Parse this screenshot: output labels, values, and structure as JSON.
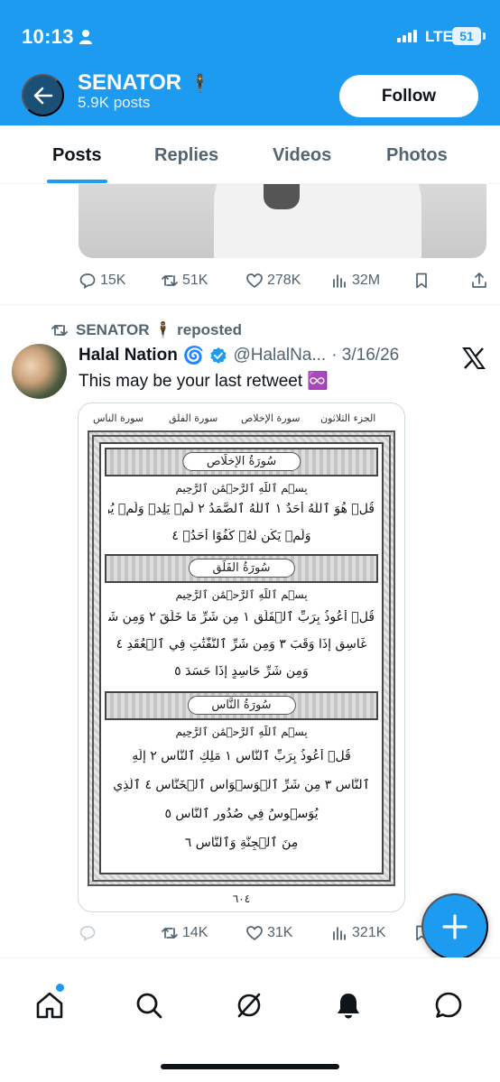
{
  "status_bar": {
    "time": "10:13",
    "network": "LTE",
    "battery": "51"
  },
  "header": {
    "name": "SENATOR",
    "name_emoji": "🕴",
    "posts": "5.9K posts",
    "follow_label": "Follow"
  },
  "tabs": [
    {
      "label": "Posts",
      "active": true
    },
    {
      "label": "Replies",
      "active": false
    },
    {
      "label": "Videos",
      "active": false
    },
    {
      "label": "Photos",
      "active": false
    }
  ],
  "previous_post": {
    "replies": "15K",
    "reposts": "51K",
    "likes": "278K",
    "views": "32M"
  },
  "repost": {
    "reposter": "SENATOR 🕴 reposted",
    "author": "Halal Nation",
    "author_emoji": "🌀",
    "handle": "@HalalNa...",
    "date": "· 3/16/26",
    "text": "This may be your last retweet ♾️",
    "quran_page": {
      "header_right": "الجزء الثلاثون",
      "header_mid1": "سورة الإخلاص",
      "header_mid2": "سورة الفلق",
      "header_left": "سورة الناس",
      "surah1_title": "سُورَةُ الإخلَاص",
      "surah2_title": "سُورَةُ الفَلَق",
      "surah3_title": "سُورَةُ النَّاس",
      "basmala": "بِسۡمِ ٱللَّهِ ٱلرَّحۡمَٰنِ ٱلرَّحِيمِ",
      "s1_l1": "قُلۡ هُوَ ٱللَّهُ أَحَدٌ ١ ٱللَّهُ ٱلصَّمَدُ ٢ لَمۡ يَلِدۡ وَلَمۡ يُولَدۡ ٣",
      "s1_l2": "وَلَمۡ يَكُن لَّهُۥ كُفُوًا أَحَدُۢ ٤",
      "s2_l1": "قُلۡ أَعُوذُ بِرَبِّ ٱلۡفَلَقِ ١ مِن شَرِّ مَا خَلَقَ ٢ وَمِن شَرِّ",
      "s2_l2": "غَاسِقٍ إِذَا وَقَبَ ٣ وَمِن شَرِّ ٱلنَّفَّٰثَٰتِ فِي ٱلۡعُقَدِ ٤",
      "s2_l3": "وَمِن شَرِّ حَاسِدٍ إِذَا حَسَدَ ٥",
      "s3_l1": "قُلۡ أَعُوذُ بِرَبِّ ٱلنَّاسِ ١ مَلِكِ ٱلنَّاسِ ٢ إِلَٰهِ",
      "s3_l2": "ٱلنَّاسِ ٣ مِن شَرِّ ٱلۡوَسۡوَاسِ ٱلۡخَنَّاسِ ٤ ٱلَّذِي",
      "s3_l3": "يُوَسۡوِسُ فِي صُدُورِ ٱلنَّاسِ ٥",
      "s3_l4": "مِنَ ٱلۡجِنَّةِ وَٱلنَّاسِ ٦",
      "page_number": "٦٠٤"
    },
    "reposts": "14K",
    "likes": "31K",
    "views": "321K"
  },
  "colors": {
    "accent": "#1d9bf0",
    "text": "#0f1419",
    "muted": "#536471"
  }
}
